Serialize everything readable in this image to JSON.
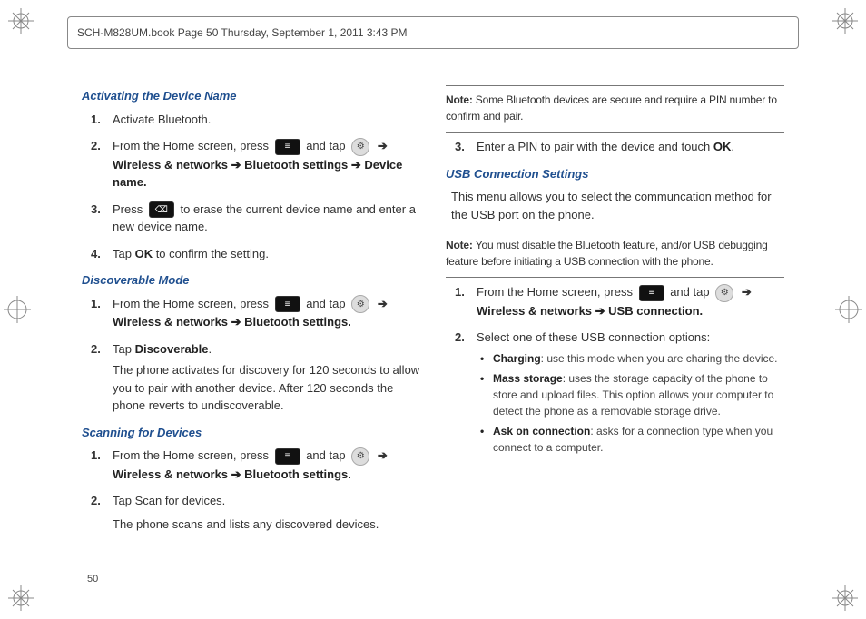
{
  "meta": {
    "crop_header": "SCH-M828UM.book  Page 50  Thursday, September 1, 2011  3:43 PM",
    "page_number": "50"
  },
  "left": {
    "activating": {
      "heading": "Activating the Device Name",
      "step1": "Activate Bluetooth.",
      "step2a": "From the Home screen, press",
      "step2b": "and tap",
      "step2c_path": "Wireless & networks ➔ Bluetooth settings ➔ Device name.",
      "step3a": "Press",
      "step3b": "to erase the current device name and enter a new device name.",
      "step4a": "Tap ",
      "step4b_ok": "OK",
      "step4c": " to confirm the setting."
    },
    "discoverable": {
      "heading": "Discoverable Mode",
      "step1a": "From the Home screen, press",
      "step1b": "and tap",
      "step1c_path": "Wireless & networks ➔ Bluetooth settings.",
      "step2a": "Tap ",
      "step2b_bold": "Discoverable",
      "step2c": ".",
      "step2d_body": "The phone activates for discovery for 120 seconds to allow you to pair with another device. After 120 seconds the phone reverts to undiscoverable."
    },
    "scanning": {
      "heading": "Scanning for Devices",
      "step1a": "From the Home screen, press",
      "step1b": "and tap",
      "step1c_path": "Wireless & networks ➔ Bluetooth settings.",
      "step2": "Tap Scan for devices.",
      "step2_body": "The phone scans and lists any discovered devices."
    }
  },
  "right": {
    "note1_label": "Note: ",
    "note1_body": "Some Bluetooth devices are secure and require a PIN number to confirm and pair.",
    "step3a": "Enter a PIN to pair with the device and touch ",
    "step3b_ok": "OK",
    "step3c": ".",
    "usb": {
      "heading": "USB Connection Settings",
      "intro": "This menu allows you to select the communcation method for the USB port on the phone."
    },
    "note2_label": "Note: ",
    "note2_body": "You must disable the Bluetooth feature, and/or USB debugging feature before initiating a USB connection with the phone.",
    "step1a": "From the Home screen, press",
    "step1b": "and tap",
    "step1c_path": "Wireless & networks ➔ USB connection.",
    "step2": "Select one of these USB connection options:",
    "bullets": {
      "charging_b": "Charging",
      "charging_t": ": use this mode when you are charing the device.",
      "mass_b": "Mass storage",
      "mass_t": ": uses the storage capacity of the phone to store and upload files. This option allows your computer to detect the phone as a removable storage drive.",
      "ask_b": "Ask on connection",
      "ask_t": ": asks for a connection type when you connect to a computer."
    }
  },
  "icons": {
    "menu": "menu-key-icon",
    "gear": "settings-gear-icon",
    "back": "backspace-key-icon",
    "arrow": "➔"
  }
}
